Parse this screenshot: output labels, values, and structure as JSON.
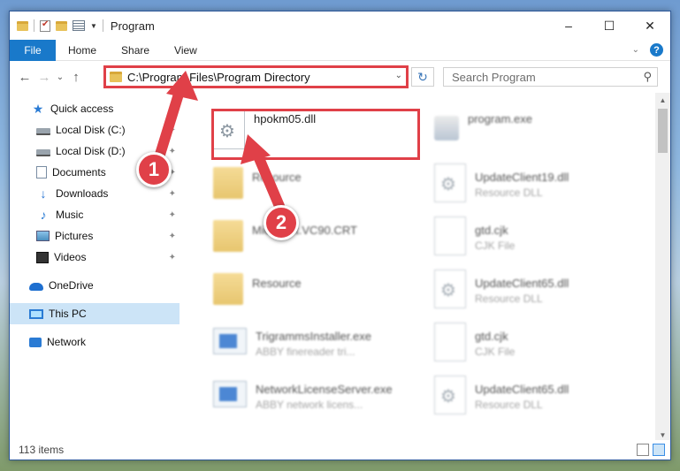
{
  "window": {
    "title": "Program",
    "quick_access_icons": [
      "folder-icon",
      "properties-check-icon",
      "new-folder-icon",
      "properties-icon",
      "customize-dropdown-icon"
    ],
    "controls": {
      "minimize": "–",
      "maximize": "☐",
      "close": "✕"
    }
  },
  "ribbon": {
    "tabs": [
      "File",
      "Home",
      "Share",
      "View"
    ],
    "expand_glyph": "⌄",
    "help_glyph": "?"
  },
  "nav": {
    "back": "←",
    "forward": "→",
    "recent": "⌄",
    "up": "↑",
    "address": "C:\\Program Files\\Program Directory",
    "address_dropdown": "⌄",
    "refresh": "↻",
    "search_placeholder": "Search Program",
    "search_glyph": "⚲"
  },
  "sidebar": {
    "items": [
      {
        "label": "Quick access",
        "icon": "star-icon",
        "pinned": false
      },
      {
        "label": "Local Disk (C:)",
        "icon": "drive-icon",
        "pinned": true
      },
      {
        "label": "Local Disk (D:)",
        "icon": "drive-icon",
        "pinned": true
      },
      {
        "label": "Documents",
        "icon": "documents-icon",
        "pinned": true
      },
      {
        "label": "Downloads",
        "icon": "downloads-icon",
        "pinned": true
      },
      {
        "label": "Music",
        "icon": "music-icon",
        "pinned": true
      },
      {
        "label": "Pictures",
        "icon": "pictures-icon",
        "pinned": true
      },
      {
        "label": "Videos",
        "icon": "videos-icon",
        "pinned": true
      },
      {
        "label": "OneDrive",
        "icon": "onedrive-icon",
        "pinned": false
      },
      {
        "label": "This PC",
        "icon": "this-pc-icon",
        "pinned": false,
        "selected": true
      },
      {
        "label": "Network",
        "icon": "network-icon",
        "pinned": false
      }
    ],
    "pin_glyph": "📌"
  },
  "files": [
    {
      "name": "hpokm05.dll",
      "desc": "",
      "type": "dll",
      "highlighted": true
    },
    {
      "name": "program.exe",
      "desc": "",
      "type": "exe"
    },
    {
      "name": "Resource",
      "desc": "",
      "type": "folder"
    },
    {
      "name": "UpdateClient19.dll",
      "desc": "Resource DLL",
      "type": "dll"
    },
    {
      "name": "Microsoft.VC90.CRT",
      "desc": "",
      "type": "folder"
    },
    {
      "name": "gtd.cjk",
      "desc": "CJK File",
      "type": "doc"
    },
    {
      "name": "Resource",
      "desc": "",
      "type": "folder"
    },
    {
      "name": "UpdateClient65.dll",
      "desc": "Resource DLL",
      "type": "dll"
    },
    {
      "name": "TrigrammsInstaller.exe",
      "desc": "ABBY finereader tri...",
      "type": "app"
    },
    {
      "name": "gtd.cjk",
      "desc": "CJK File",
      "type": "doc"
    },
    {
      "name": "NetworkLicenseServer.exe",
      "desc": "ABBY network licens...",
      "type": "app"
    },
    {
      "name": "UpdateClient65.dll",
      "desc": "Resource DLL",
      "type": "dll"
    }
  ],
  "status": {
    "item_count": "113 items"
  },
  "annotations": {
    "step1": "1",
    "step2": "2"
  },
  "colors": {
    "accent": "#1979ca",
    "highlight": "#e04048",
    "selected": "#cce4f7"
  }
}
